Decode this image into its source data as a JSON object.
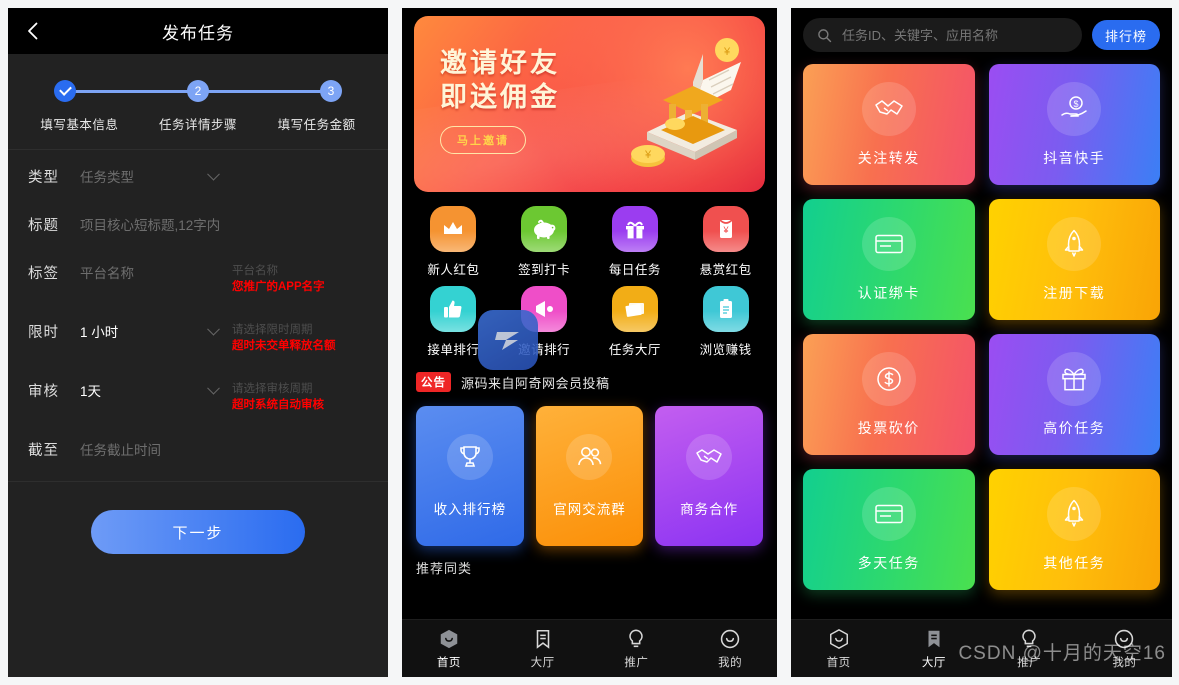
{
  "publish": {
    "header": {
      "title": "发布任务",
      "back_icon": "chevron-left-icon"
    },
    "steps": [
      {
        "badge": "✓",
        "label": "填写基本信息",
        "state": "done"
      },
      {
        "badge": "2",
        "label": "任务详情步骤",
        "state": "todo"
      },
      {
        "badge": "3",
        "label": "填写任务金额",
        "state": "todo"
      }
    ],
    "fields": [
      {
        "label": "类型",
        "value": "",
        "placeholder": "任务类型",
        "caret": true,
        "hint_gray": "",
        "hint_red": ""
      },
      {
        "label": "标题",
        "value": "",
        "placeholder": "项目核心短标题,12字内",
        "caret": false,
        "hint_gray": "",
        "hint_red": ""
      },
      {
        "label": "标签",
        "value": "",
        "placeholder": "平台名称",
        "caret": false,
        "hint_gray": "平台名称",
        "hint_red": "您推广的APP名字"
      },
      {
        "label": "限时",
        "value": "1 小时",
        "placeholder": "",
        "caret": true,
        "hint_gray": "请选择限时周期",
        "hint_red": "超时未交单释放名额"
      },
      {
        "label": "审核",
        "value": "1天",
        "placeholder": "",
        "caret": true,
        "hint_gray": "请选择审核周期",
        "hint_red": "超时系统自动审核"
      },
      {
        "label": "截至",
        "value": "",
        "placeholder": "任务截止时间",
        "caret": false,
        "hint_gray": "",
        "hint_red": ""
      }
    ],
    "next_label": "下一步",
    "accent": "#2a6cf0",
    "step_inactive": "#7da4f5",
    "hint_red_color": "#ff0000"
  },
  "home": {
    "banner": {
      "line1": "邀请好友",
      "line2": "即送佣金",
      "button": "马上邀请",
      "art_icon": "bank-coins-illustration",
      "color_start": "#ff8a3d",
      "color_end": "#e01f3a"
    },
    "grid": [
      {
        "label": "新人红包",
        "icon": "crown-icon",
        "color": "#f59331"
      },
      {
        "label": "签到打卡",
        "icon": "piggy-bank-icon",
        "color": "#6cc832"
      },
      {
        "label": "每日任务",
        "icon": "gift-icon",
        "color": "#9b3df0"
      },
      {
        "label": "悬赏红包",
        "icon": "red-packet-icon",
        "color": "#f0504f"
      },
      {
        "label": "接单排行",
        "icon": "thumb-up-icon",
        "color": "#34d2d2"
      },
      {
        "label": "邀请排行",
        "icon": "megaphone-icon",
        "color": "#ef4ec8"
      },
      {
        "label": "任务大厅",
        "icon": "documents-icon",
        "color": "#f2ad16"
      },
      {
        "label": "浏览赚钱",
        "icon": "clipboard-icon",
        "color": "#3fc8d6"
      }
    ],
    "notice": {
      "tag": "公告",
      "text": "源码来自阿奇网会员投稿"
    },
    "cards": [
      {
        "label": "收入排行榜",
        "icon": "trophy-icon",
        "theme": "c-blue"
      },
      {
        "label": "官网交流群",
        "icon": "group-icon",
        "theme": "c-orange"
      },
      {
        "label": "商务合作",
        "icon": "handshake-icon",
        "theme": "c-purple"
      }
    ],
    "section_cut_title": "推荐同类",
    "watermark_logo": "z-logo-watermark",
    "tabs": [
      {
        "label": "首页",
        "icon": "home-hexagon-icon",
        "active": true
      },
      {
        "label": "大厅",
        "icon": "bookmark-icon",
        "active": false
      },
      {
        "label": "推广",
        "icon": "bulb-icon",
        "active": false
      },
      {
        "label": "我的",
        "icon": "smiley-circle-icon",
        "active": false
      }
    ]
  },
  "hall": {
    "search": {
      "icon": "search-icon",
      "value": "",
      "placeholder": "任务ID、关键字、应用名称"
    },
    "rank_button": "排行榜",
    "cards": [
      {
        "label": "关注转发",
        "icon": "handshake-icon",
        "theme": "g-or"
      },
      {
        "label": "抖音快手",
        "icon": "hand-coin-icon",
        "theme": "g-pub"
      },
      {
        "label": "认证绑卡",
        "icon": "credit-card-icon",
        "theme": "g-gr"
      },
      {
        "label": "注册下载",
        "icon": "rocket-icon",
        "theme": "g-ye"
      },
      {
        "label": "投票砍价",
        "icon": "dollar-coin-icon",
        "theme": "g-or"
      },
      {
        "label": "高价任务",
        "icon": "gift-icon",
        "theme": "g-pub"
      },
      {
        "label": "多天任务",
        "icon": "credit-card-icon",
        "theme": "g-gr"
      },
      {
        "label": "其他任务",
        "icon": "rocket-icon",
        "theme": "g-ye"
      }
    ],
    "tabs": [
      {
        "label": "首页",
        "icon": "home-hexagon-icon",
        "active": false
      },
      {
        "label": "大厅",
        "icon": "bookmark-icon",
        "active": true
      },
      {
        "label": "推广",
        "icon": "bulb-icon",
        "active": false
      },
      {
        "label": "我的",
        "icon": "smiley-circle-icon",
        "active": false
      }
    ],
    "watermark_text": "CSDN @十月的天空16"
  }
}
